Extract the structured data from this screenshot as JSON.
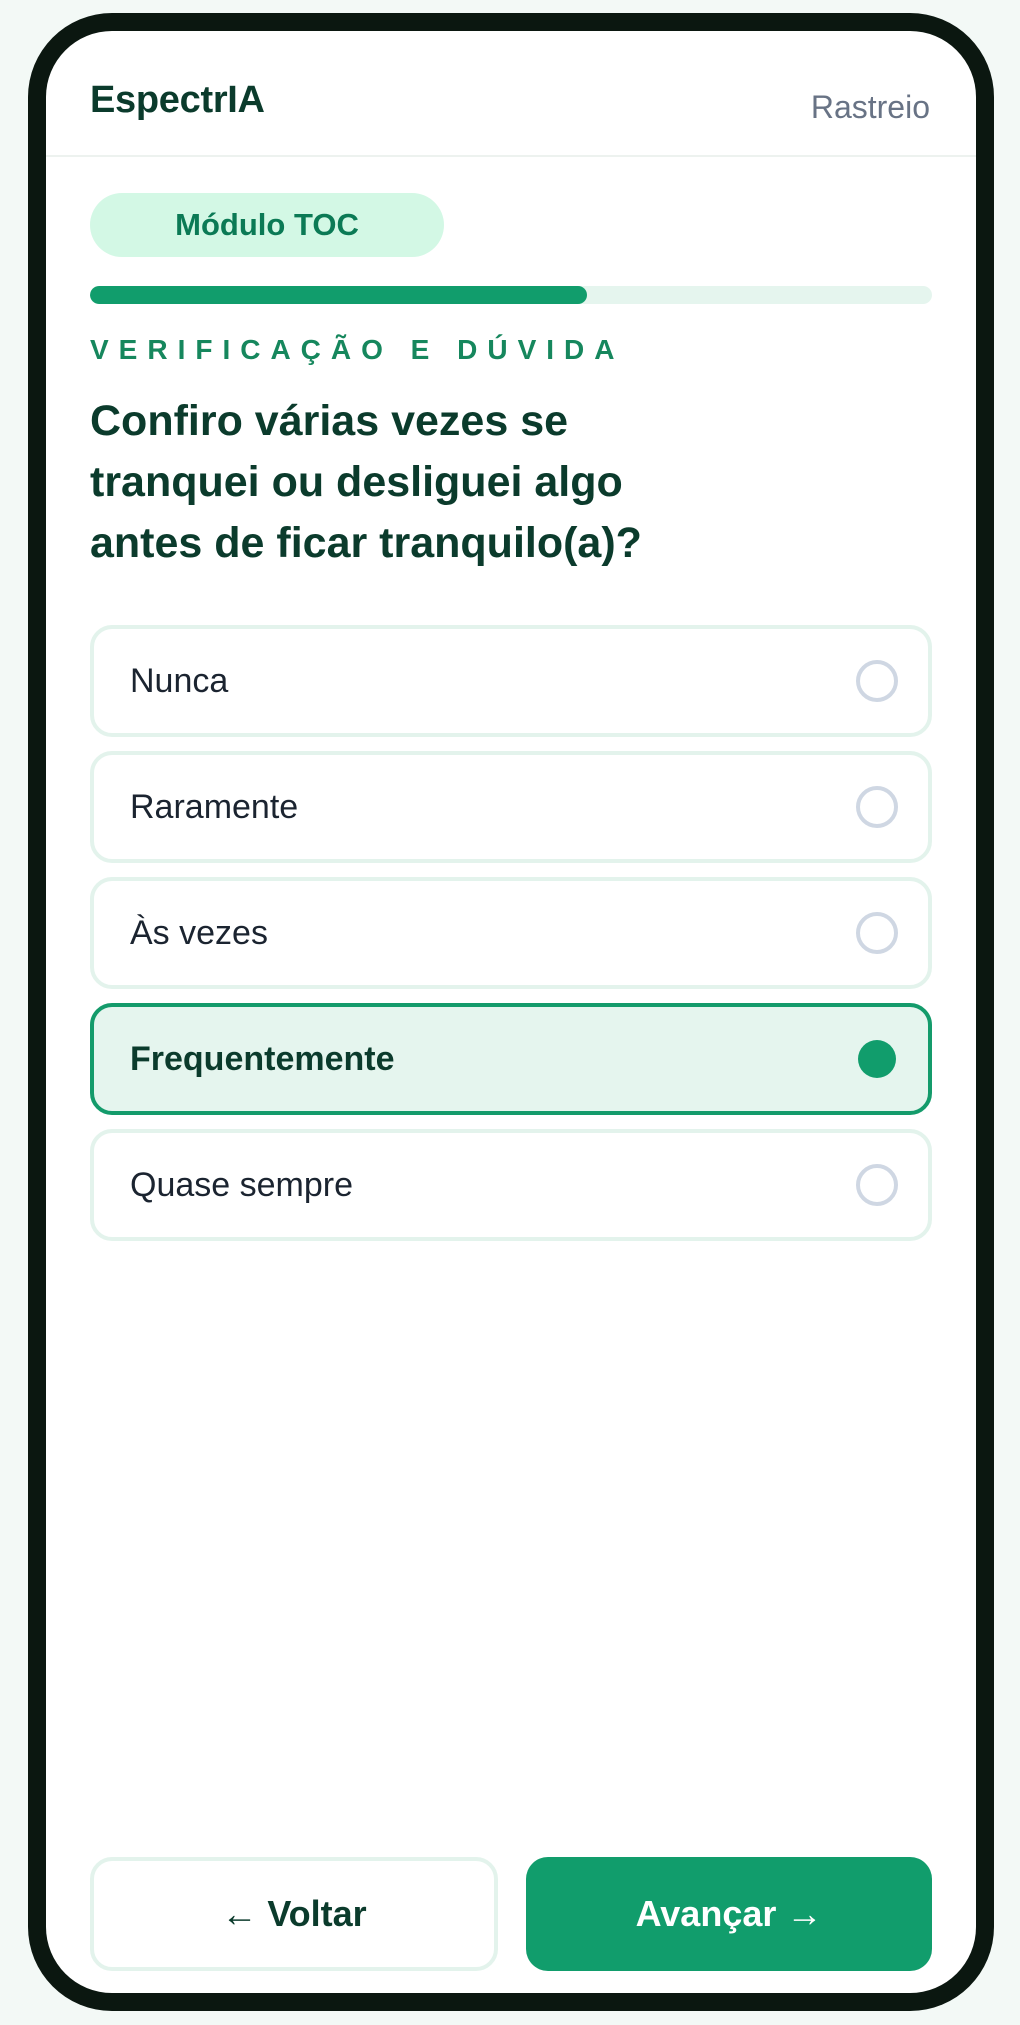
{
  "header": {
    "brand": "EspectrIA",
    "subtitle": "Rastreio"
  },
  "module": {
    "label": "Módulo TOC"
  },
  "progress": {
    "fraction": 0.59
  },
  "question": {
    "category": "VERIFICAÇÃO E DÚVIDA",
    "text": "Confiro várias vezes se tranquei ou desliguei algo antes de ficar tranquilo(a)?"
  },
  "options": [
    {
      "label": "Nunca",
      "selected": false
    },
    {
      "label": "Raramente",
      "selected": false
    },
    {
      "label": "Às vezes",
      "selected": false
    },
    {
      "label": "Frequentemente",
      "selected": true
    },
    {
      "label": "Quase sempre",
      "selected": false
    }
  ],
  "footer": {
    "back_label": "← Voltar",
    "next_label": "Avançar →"
  },
  "colors": {
    "accent": "#119d6c",
    "brand_text": "#0b3b2c",
    "pill_bg": "#d3f8e5",
    "selected_bg": "#e5f5ee"
  }
}
